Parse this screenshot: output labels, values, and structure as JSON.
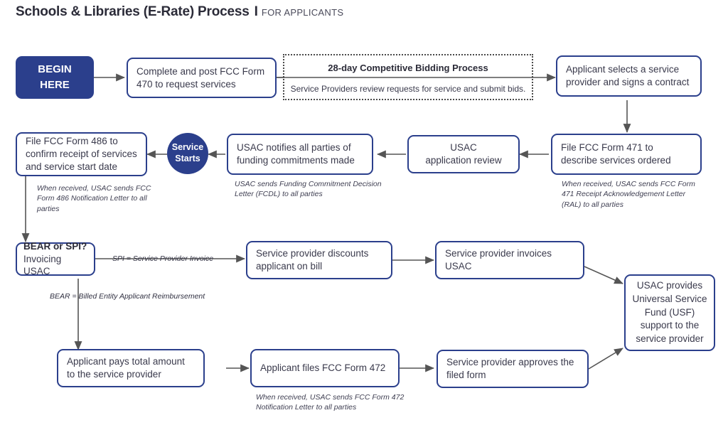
{
  "header": {
    "title": "Schools & Libraries (E-Rate) Process",
    "divider": "I",
    "subtitle": "FOR APPLICANTS"
  },
  "colors": {
    "brand_navy": "#2b3f8c",
    "box_border": "#2b3f8c",
    "text": "#3a3a4c",
    "arrow": "#555555",
    "dotted_border": "#4a4a4a"
  },
  "nodes": {
    "begin": "BEGIN\nHERE",
    "form470": "Complete and post FCC Form 470 to request services",
    "bidding_title": "28-day Competitive Bidding Process",
    "bidding_sub": "Service Providers review requests for service and submit bids.",
    "select_provider": "Applicant selects a service provider and signs a contract",
    "form471": "File FCC Form 471 to describe services ordered",
    "form471_note": "When received, USAC sends FCC Form 471 Receipt Acknowledgement Letter (RAL) to all parties",
    "usac_review": "USAC\napplication review",
    "usac_notifies": "USAC notifies all parties of funding commitments made",
    "usac_notifies_note": "USAC sends Funding Commitment Decision Letter (FCDL) to all parties",
    "service_starts": "Service\nStarts",
    "form486": "File FCC Form 486 to confirm receipt of services and service start date",
    "form486_note": "When received, USAC sends FCC Form 486 Notification Letter to all parties",
    "bear_spi_strong": "BEAR or SPI?",
    "bear_spi_rest": "Invoicing USAC",
    "spi_label": "SPI = Service Provider Invoice",
    "bear_label": "BEAR = Billed Entity\nApplicant Reimbursement",
    "sp_discounts": "Service provider discounts applicant on bill",
    "sp_invoices": "Service provider invoices USAC",
    "usf_support": "USAC provides Universal Service Fund (USF) support to the service provider",
    "applicant_pays": "Applicant pays total amount to the service provider",
    "form472": "Applicant files FCC Form 472",
    "form472_note": "When received, USAC sends FCC Form 472 Notification Letter to all parties",
    "sp_approves": "Service provider approves the filed form"
  }
}
